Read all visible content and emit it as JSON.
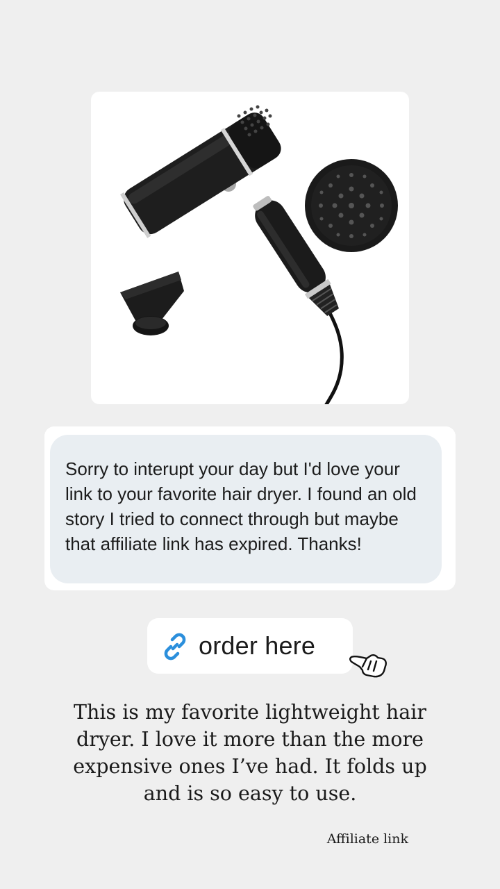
{
  "product": {
    "image_description_icon": "hair-dryer-with-diffuser-and-concentrator"
  },
  "message": {
    "text": "Sorry to interupt your day but I'd love your link to your favorite hair dryer. I found an old story I tried to connect through but maybe that affiliate link has expired. Thanks!"
  },
  "link_sticker": {
    "label": "order here",
    "icon": "link-icon",
    "icon_color": "#2b8fdc"
  },
  "pointer": {
    "icon": "pointing-hand-icon"
  },
  "caption": {
    "text": "This is my favorite lightweight hair dryer. I love it more than the more expensive ones I’ve had. It folds up and is so easy to use."
  },
  "disclosure": {
    "text": "Affiliate link"
  },
  "colors": {
    "background": "#efefef",
    "bubble": "#e9eef2",
    "card": "#ffffff"
  }
}
